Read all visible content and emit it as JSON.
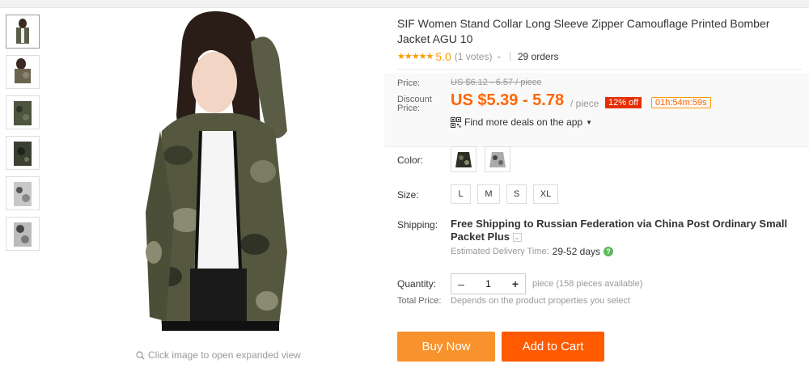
{
  "product": {
    "title": "SIF Women Stand Collar Long Sleeve Zipper Camouflage Printed Bomber Jacket AGU 10",
    "stars": "★★★★★",
    "rating": "5.0",
    "votes": "(1 votes)",
    "orders": "29 orders"
  },
  "price": {
    "price_label": "Price:",
    "original": "US $6.12 - 6.57 / piece",
    "discount_label_1": "Discount",
    "discount_label_2": "Price:",
    "discount": "US $5.39 - 5.78",
    "per_piece": "/ piece",
    "off_badge": "12% off",
    "timer": "01h:54m:59s",
    "app_deals": "Find more deals on the app"
  },
  "options": {
    "color_label": "Color:",
    "size_label": "Size:",
    "sizes": [
      "L",
      "M",
      "S",
      "XL"
    ],
    "shipping_label": "Shipping:",
    "shipping_text": "Free Shipping to Russian Federation via China Post Ordinary Small Packet Plus",
    "eta_label": "Estimated Delivery Time:",
    "eta_days": "29-52 days",
    "quantity_label": "Quantity:",
    "quantity_value": "1",
    "quantity_note": "piece (158 pieces available)",
    "total_label": "Total Price:",
    "total_value": "Depends on the product properties you select"
  },
  "gallery": {
    "zoom_hint": "Click image to open expanded view"
  },
  "actions": {
    "buy_now": "Buy Now",
    "add_to_cart": "Add to Cart"
  },
  "colors": {
    "accent": "#ff6600",
    "badge": "#e62e04",
    "buy_btn": "#f7922c",
    "cart_btn": "#ff5a00",
    "stars": "#ff9900"
  },
  "icons": {
    "zoom": "magnifier-icon",
    "qr": "qr-code-icon",
    "help": "help-icon"
  }
}
